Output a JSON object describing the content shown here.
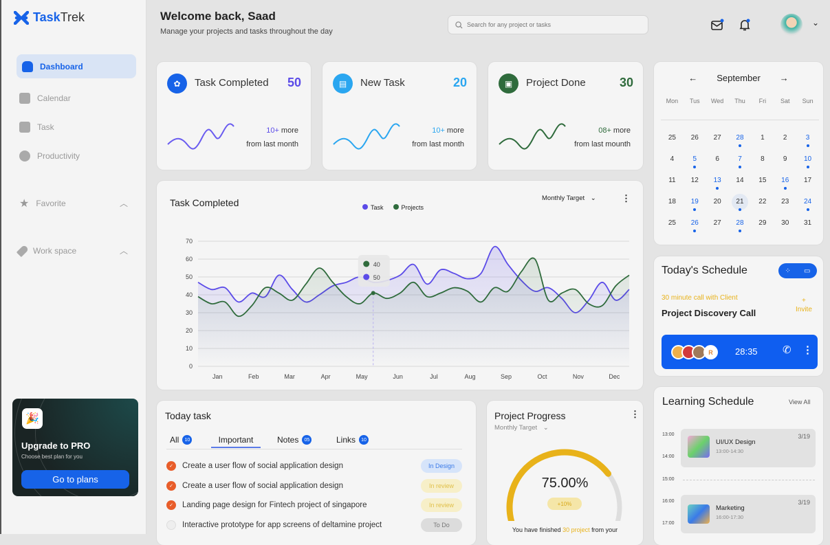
{
  "app": {
    "logo_a": "Task",
    "logo_b": "Trek"
  },
  "sidebar": {
    "items": [
      {
        "label": "Dashboard",
        "icon": "home-icon"
      },
      {
        "label": "Calendar",
        "icon": "calendar-icon"
      },
      {
        "label": "Task",
        "icon": "mail-icon"
      },
      {
        "label": "Productivity",
        "icon": "pie-chart-icon"
      }
    ],
    "sections": [
      {
        "label": "Favorite",
        "icon": "star-icon"
      },
      {
        "label": "Work space",
        "icon": "rocket-icon"
      }
    ],
    "upgrade": {
      "title": "Upgrade to PRO",
      "subtitle": "Choose best plan for you",
      "button": "Go to plans"
    }
  },
  "header": {
    "title": "Welcome back, Saad",
    "subtitle": "Manage your projects and tasks throughout the day",
    "search_placeholder": "Search for any project or tasks"
  },
  "stats": [
    {
      "label": "Task Completed",
      "value": "50",
      "more_num": "10+",
      "more": " more",
      "from": "from last month",
      "color": "#5b4be8",
      "icon_bg": "#1763e8"
    },
    {
      "label": "New Task",
      "value": "20",
      "more_num": "10+",
      "more": " more",
      "from": "from last month",
      "color": "#2aa6f0",
      "icon_bg": "#2aa6f0"
    },
    {
      "label": "Project Done",
      "value": "30",
      "more_num": "08+",
      "more": " more",
      "from": "from last mounth",
      "color": "#2f6b3c",
      "icon_bg": "#2f6b3c"
    }
  ],
  "chart_data": {
    "type": "line",
    "title": "Task Completed",
    "dropdown": "Monthly Target",
    "categories": [
      "Jan",
      "Feb",
      "Mar",
      "Apr",
      "May",
      "Jun",
      "Jul",
      "Aug",
      "Sep",
      "Oct",
      "Nov",
      "Dec"
    ],
    "yticks": [
      0,
      10,
      20,
      30,
      40,
      50,
      60,
      70
    ],
    "ylim": [
      0,
      70
    ],
    "grid": true,
    "legend": "top-center",
    "series": [
      {
        "name": "Task",
        "color": "#5b4be8",
        "values": [
          47,
          43,
          44,
          36,
          41,
          39,
          51,
          43,
          36,
          40,
          45,
          47,
          50,
          47,
          48,
          51,
          57,
          46,
          54,
          52,
          49,
          52,
          67,
          57,
          48,
          42,
          44,
          38,
          30,
          37,
          47,
          37,
          43
        ]
      },
      {
        "name": "Projects",
        "color": "#2f6b3c",
        "values": [
          39,
          35,
          36,
          28,
          34,
          44,
          41,
          37,
          46,
          55,
          47,
          39,
          35,
          41,
          38,
          41,
          47,
          39,
          41,
          44,
          42,
          36,
          44,
          42,
          53,
          60,
          37,
          41,
          43,
          35,
          34,
          45,
          51
        ]
      }
    ],
    "tooltip": {
      "projects": "40",
      "task": "50"
    }
  },
  "calendar": {
    "month": "September",
    "dows": [
      "Mon",
      "Tus",
      "Wed",
      "Thu",
      "Fri",
      "Sat",
      "Sun"
    ],
    "days": [
      [
        "25",
        0
      ],
      [
        "26",
        0
      ],
      [
        "27",
        0
      ],
      [
        "28",
        1
      ],
      [
        "1",
        0
      ],
      [
        "2",
        0
      ],
      [
        "3",
        1
      ],
      [
        "4",
        0
      ],
      [
        "5",
        1
      ],
      [
        "6",
        0
      ],
      [
        "7",
        1
      ],
      [
        "8",
        0
      ],
      [
        "9",
        0
      ],
      [
        "10",
        1
      ],
      [
        "11",
        0
      ],
      [
        "12",
        0
      ],
      [
        "13",
        1
      ],
      [
        "14",
        0
      ],
      [
        "15",
        0
      ],
      [
        "16",
        1
      ],
      [
        "17",
        0
      ],
      [
        "18",
        0
      ],
      [
        "19",
        1
      ],
      [
        "20",
        0
      ],
      [
        "21",
        2
      ],
      [
        "22",
        0
      ],
      [
        "23",
        0
      ],
      [
        "24",
        1
      ],
      [
        "25",
        0
      ],
      [
        "26",
        1
      ],
      [
        "27",
        0
      ],
      [
        "28",
        1
      ],
      [
        "29",
        0
      ],
      [
        "30",
        0
      ],
      [
        "31",
        0
      ]
    ]
  },
  "schedule": {
    "title": "Today's Schedule",
    "subtitle": "30 minute call with Client",
    "event": "Project Discovery Call",
    "invite_plus": "+",
    "invite": "Invite",
    "timer": "28:35",
    "avatar_initial": "R"
  },
  "learning": {
    "title": "Learning Schedule",
    "view_all": "View All",
    "times": [
      "13:00",
      "14:00",
      "15:00",
      "16:00",
      "17:00"
    ],
    "items": [
      {
        "title": "UI/UX Design",
        "time": "13:00-14:30",
        "date": "3/19"
      },
      {
        "title": "Marketing",
        "time": "16:00-17:30",
        "date": "3/19"
      }
    ]
  },
  "today_task": {
    "title": "Today task",
    "tabs": [
      {
        "label": "All",
        "count": "10"
      },
      {
        "label": "Important"
      },
      {
        "label": "Notes",
        "count": "05"
      },
      {
        "label": "Links",
        "count": "10"
      }
    ],
    "rows": [
      {
        "text": "Create a user flow of social application design",
        "status": "In Design",
        "done": true
      },
      {
        "text": "Create a user flow of social application design",
        "status": "In review",
        "done": true
      },
      {
        "text": "Landing page design for Fintech project of singapore",
        "status": "In review",
        "done": true
      },
      {
        "text": "Interactive prototype for app screens of deltamine project",
        "status": "To Do",
        "done": false
      }
    ]
  },
  "progress": {
    "title": "Project Progress",
    "dropdown": "Monthly Target",
    "percent": 75,
    "percent_label": "75.00%",
    "delta": "+10%",
    "footer_a": "You have finished ",
    "footer_b": "30 project",
    "footer_c": " from your"
  }
}
